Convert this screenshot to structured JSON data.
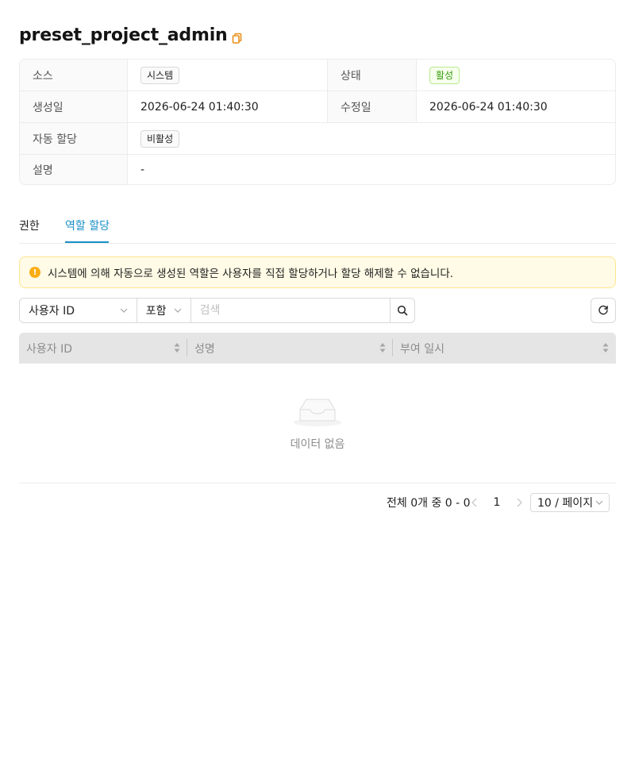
{
  "title": "preset_project_admin",
  "details": {
    "source_label": "소스",
    "source_value": "시스템",
    "status_label": "상태",
    "status_value": "활성",
    "created_label": "생성일",
    "created_value": "2026-06-24 01:40:30",
    "modified_label": "수정일",
    "modified_value": "2026-06-24 01:40:30",
    "auto_assign_label": "자동 할당",
    "auto_assign_value": "비활성",
    "description_label": "설명",
    "description_value": "-"
  },
  "tabs": [
    {
      "label": "권한",
      "active": false
    },
    {
      "label": "역할 할당",
      "active": true
    }
  ],
  "alert": {
    "icon": "exclamation-circle-icon",
    "color": "#faad14",
    "text": "시스템에 의해 자동으로 생성된 역할은 사용자를 직접 할당하거나 할당 해제할 수 없습니다."
  },
  "search": {
    "field_select": "사용자 ID",
    "operator_select": "포함",
    "placeholder": "검색",
    "value": ""
  },
  "table": {
    "columns": [
      "사용자 ID",
      "성명",
      "부여 일시"
    ],
    "rows": [],
    "empty_text": "데이터 없음"
  },
  "pagination": {
    "total_text": "전체 0개 중 0 - 0",
    "current_page": "1",
    "page_size": "10 / 페이지"
  },
  "colors": {
    "accent": "#1890c8",
    "status_green": "#389e0d",
    "warning": "#faad14"
  }
}
